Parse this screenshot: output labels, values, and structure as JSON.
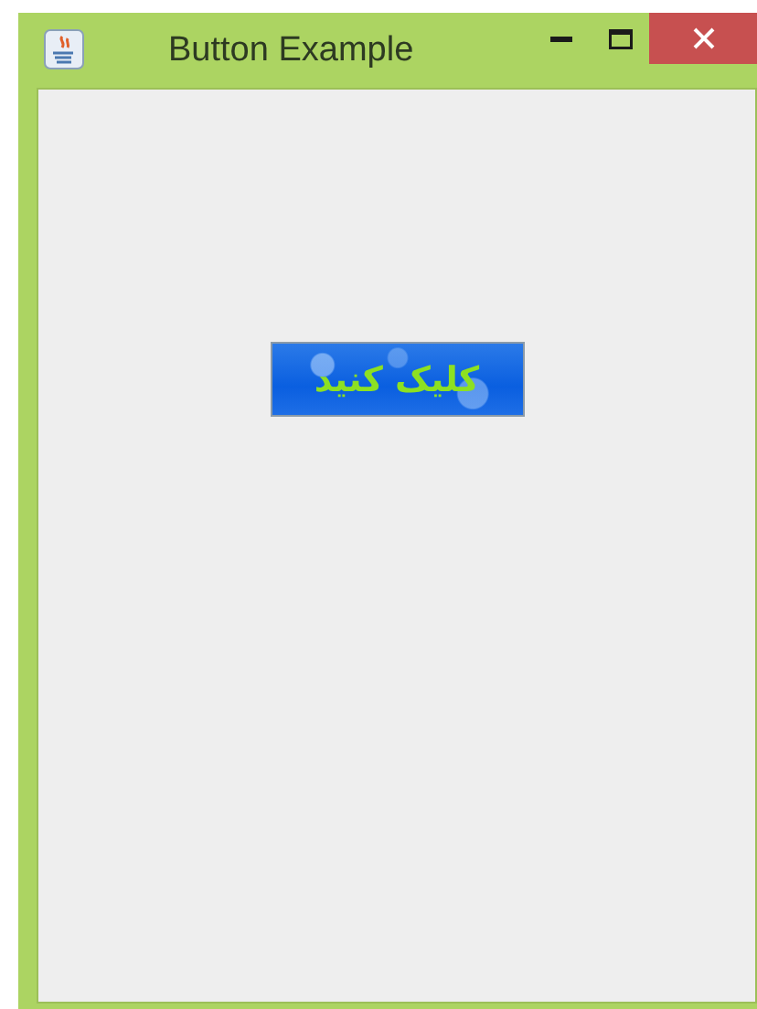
{
  "window": {
    "title": "Button Example"
  },
  "button": {
    "label": "کلیک کنید"
  }
}
